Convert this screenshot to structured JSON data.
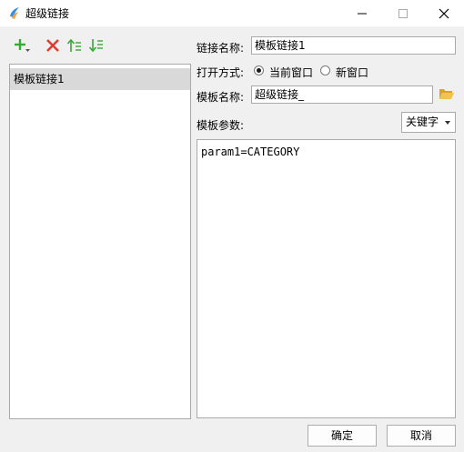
{
  "window": {
    "title": "超级链接"
  },
  "toolbar": {
    "add_icon": "plus-dropdown-icon",
    "delete_icon": "red-x-icon",
    "move_up_icon": "arrow-up-list-icon",
    "move_down_icon": "arrow-down-list-icon",
    "accent_color": "#38a838",
    "delete_color": "#e03c31"
  },
  "link_list": {
    "items": [
      {
        "label": "模板链接1",
        "selected": true
      }
    ]
  },
  "form": {
    "link_name_label": "链接名称:",
    "link_name_value": "模板链接1",
    "open_mode_label": "打开方式:",
    "open_mode_current": "当前窗口",
    "open_mode_new": "新窗口",
    "template_name_label": "模板名称:",
    "template_name_value": "超级链接_",
    "template_params_label": "模板参数:",
    "param_type_selected": "关键字",
    "params_text": "param1=CATEGORY"
  },
  "footer": {
    "ok_label": "确定",
    "cancel_label": "取消"
  }
}
